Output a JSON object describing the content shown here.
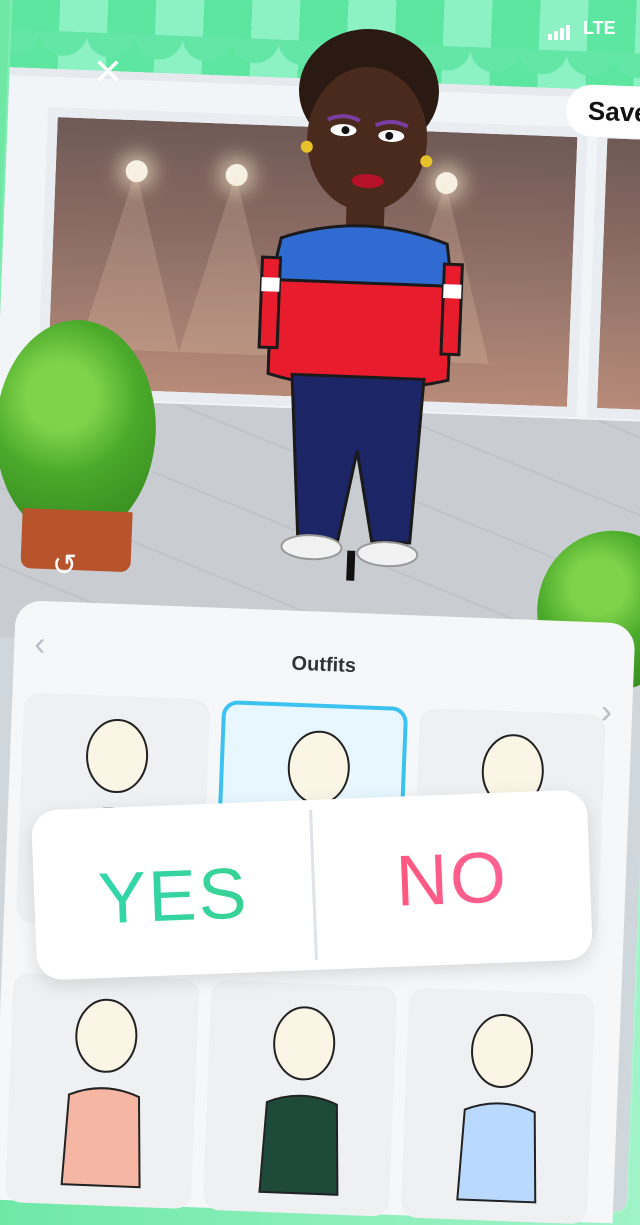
{
  "header": {
    "close_icon": "close-icon",
    "save_label": "Save",
    "network_label": "LTE",
    "undo_icon": "undo-icon"
  },
  "panel": {
    "title": "Outfits",
    "prev_icon": "chevron-left-icon",
    "next_icon": "chevron-right-icon"
  },
  "poll": {
    "yes_label": "YES",
    "no_label": "NO",
    "colors": {
      "yes": "#2ed8b4",
      "no": "#ff4f6f"
    }
  },
  "outfits": [
    {
      "top_color": "#ffffff",
      "accent": "#e04a5c",
      "selected": false
    },
    {
      "top_color": "#e7f6ff",
      "accent": "#3cc2f0",
      "selected": true
    },
    {
      "top_color": "#ffffff",
      "accent": "#222222",
      "selected": false
    },
    {
      "top_color": "#f6b6a4",
      "accent": "#f6b6a4",
      "selected": false
    },
    {
      "top_color": "#1e4a3a",
      "accent": "#1e4a3a",
      "selected": false
    },
    {
      "top_color": "#b9d9ff",
      "accent": "#b9d9ff",
      "selected": false
    }
  ],
  "accent_colors": {
    "awning_green": "#5ce6a0",
    "sweater_blue": "#2f6bd1",
    "sweater_red": "#e81c2c",
    "pants_navy": "#1c2566"
  }
}
